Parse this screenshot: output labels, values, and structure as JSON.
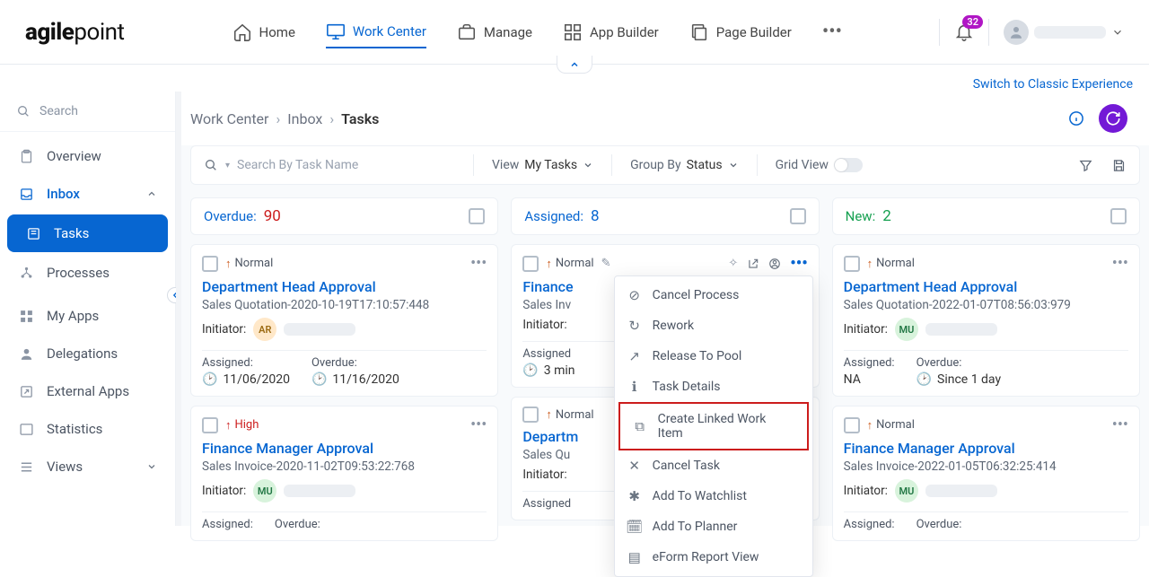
{
  "nav": {
    "logo_main": "agile",
    "logo_suffix": "point",
    "items": [
      {
        "label": "Home"
      },
      {
        "label": "Work Center"
      },
      {
        "label": "Manage"
      },
      {
        "label": "App Builder"
      },
      {
        "label": "Page Builder"
      }
    ],
    "notifications": "32"
  },
  "switch_link": "Switch to Classic Experience",
  "sidebar": {
    "search": "Search",
    "items": {
      "overview": "Overview",
      "inbox": "Inbox",
      "tasks": "Tasks",
      "processes": "Processes",
      "myapps": "My Apps",
      "delegations": "Delegations",
      "external": "External Apps",
      "statistics": "Statistics",
      "views": "Views"
    }
  },
  "breadcrumb": {
    "a": "Work Center",
    "b": "Inbox",
    "c": "Tasks"
  },
  "filterbar": {
    "search_placeholder": "Search By Task Name",
    "view_label": "View",
    "view_value": "My Tasks",
    "group_label": "Group By",
    "group_value": "Status",
    "gridview": "Grid View"
  },
  "boards": {
    "overdue": {
      "label": "Overdue:",
      "count": "90"
    },
    "assigned": {
      "label": "Assigned:",
      "count": "8"
    },
    "new": {
      "label": "New:",
      "count": "2"
    }
  },
  "cards": {
    "c1": {
      "priority": "Normal",
      "title": "Department Head Approval",
      "sub": "Sales Quotation-2020-10-19T17:10:57:448",
      "initiator_label": "Initiator:",
      "badge": "AR",
      "assigned_label": "Assigned:",
      "assigned_value": "11/06/2020",
      "overdue_label": "Overdue:",
      "overdue_value": "11/16/2020"
    },
    "c2": {
      "priority": "High",
      "title": "Finance Manager Approval",
      "sub": "Sales Invoice-2020-11-02T09:53:22:768",
      "initiator_label": "Initiator:",
      "badge": "MU",
      "assigned_label": "Assigned:",
      "overdue_label": "Overdue:"
    },
    "c3": {
      "priority": "Normal",
      "title": "Finance",
      "sub": "Sales Inv",
      "initiator_label": "Initiator:",
      "assigned_label": "Assigned",
      "assigned_value": "3 min"
    },
    "c4": {
      "priority": "Normal",
      "title": "Departm",
      "sub": "Sales Qu",
      "initiator_label": "Initiator:",
      "assigned_label": "Assigned"
    },
    "c5": {
      "priority": "Normal",
      "title": "Department Head Approval",
      "sub": "Sales Quotation-2022-01-07T08:56:03:979",
      "initiator_label": "Initiator:",
      "badge": "MU",
      "assigned_label": "Assigned:",
      "assigned_value": "NA",
      "overdue_label": "Overdue:",
      "overdue_value": "Since 1 day"
    },
    "c6": {
      "priority": "Normal",
      "title": "Finance Manager Approval",
      "sub": "Sales Invoice-2022-01-05T06:32:25:414",
      "initiator_label": "Initiator:",
      "badge": "MU",
      "assigned_label": "Assigned:",
      "overdue_label": "Overdue:"
    }
  },
  "ctx": {
    "cancel_process": "Cancel Process",
    "rework": "Rework",
    "release": "Release To Pool",
    "details": "Task Details",
    "linked": "Create Linked Work Item",
    "cancel_task": "Cancel Task",
    "watchlist": "Add To Watchlist",
    "planner": "Add To Planner",
    "eform": "eForm Report View"
  }
}
